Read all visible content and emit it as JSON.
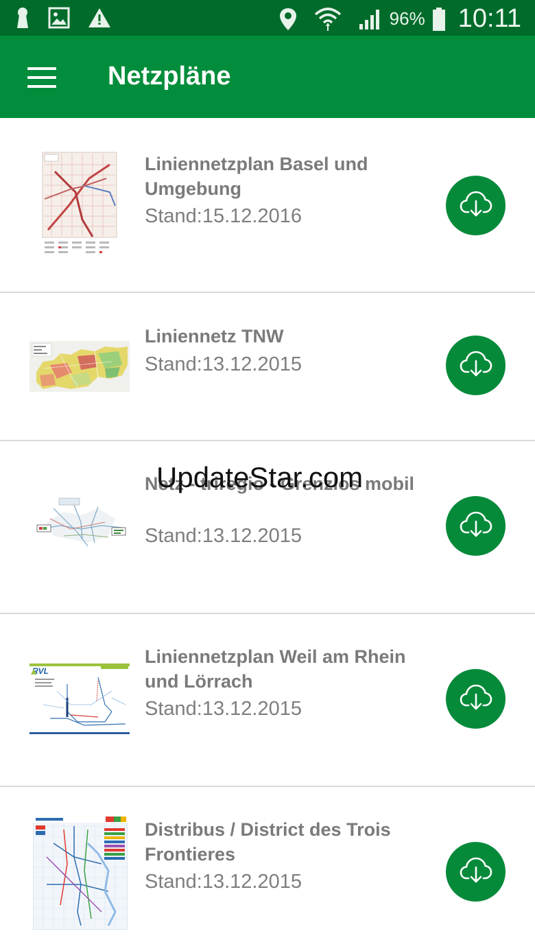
{
  "status_bar": {
    "battery_percent": "96%",
    "time": "10:11",
    "icons": [
      "keyhole-icon",
      "image-icon",
      "warning-icon",
      "location-icon",
      "wifi-icon",
      "signal-icon",
      "battery-icon"
    ]
  },
  "app_bar": {
    "title": "Netzpläne",
    "menu_icon": "hamburger-menu-icon"
  },
  "plans": [
    {
      "title": "Liniennetzplan Basel und Umgebung",
      "date": "Stand:15.12.2016"
    },
    {
      "title": "Liniennetz TNW",
      "date": "Stand:13.12.2015"
    },
    {
      "title": "Netz - triregio - Grenzlos mobil",
      "date": "Stand:13.12.2015"
    },
    {
      "title": "Liniennetzplan Weil am Rhein und Lörrach",
      "date": "Stand:13.12.2015"
    },
    {
      "title": "Distribus / District des Trois Frontieres",
      "date": "Stand:13.12.2015"
    }
  ],
  "thumbnail_labels": {
    "rvl": "RVL"
  },
  "watermark": "UpdateStar.com",
  "colors": {
    "status_bar": "#006b2a",
    "app_bar": "#018d3b",
    "download_button": "#058a3a",
    "text_gray": "#7a7a7a"
  }
}
